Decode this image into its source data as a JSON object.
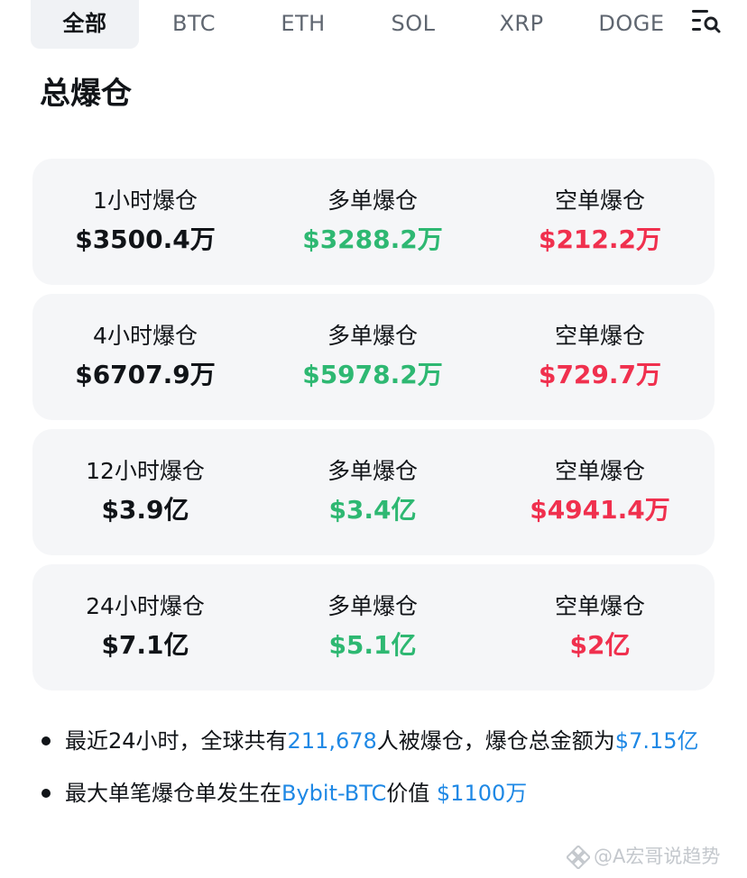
{
  "tabs": [
    {
      "label": "全部",
      "active": true
    },
    {
      "label": "BTC",
      "active": false
    },
    {
      "label": "ETH",
      "active": false
    },
    {
      "label": "SOL",
      "active": false
    },
    {
      "label": "XRP",
      "active": false
    },
    {
      "label": "DOGE",
      "active": false
    }
  ],
  "filter_icon": "search-filter-icon",
  "page_title": "总爆仓",
  "cards": [
    {
      "period": "1小时爆仓",
      "total": "$3500.4万",
      "long_label": "多单爆仓",
      "long": "$3288.2万",
      "short_label": "空单爆仓",
      "short": "$212.2万"
    },
    {
      "period": "4小时爆仓",
      "total": "$6707.9万",
      "long_label": "多单爆仓",
      "long": "$5978.2万",
      "short_label": "空单爆仓",
      "short": "$729.7万"
    },
    {
      "period": "12小时爆仓",
      "total": "$3.9亿",
      "long_label": "多单爆仓",
      "long": "$3.4亿",
      "short_label": "空单爆仓",
      "short": "$4941.4万"
    },
    {
      "period": "24小时爆仓",
      "total": "$7.1亿",
      "long_label": "多单爆仓",
      "long": "$5.1亿",
      "short_label": "空单爆仓",
      "short": "$2亿"
    }
  ],
  "summary": {
    "line1": {
      "prefix": "最近24小时，全球共有",
      "count": "211,678",
      "middle": "人被爆仓，爆仓总金额为",
      "amount": "$7.15亿"
    },
    "line2": {
      "prefix": "最大单笔爆仓单发生在",
      "exchange": "Bybit-BTC",
      "middle": "价值 ",
      "amount": "$1100万"
    }
  },
  "watermark": "@A宏哥说趋势",
  "colors": {
    "long": "#2eb872",
    "short": "#f0304e",
    "highlight": "#1e88e5",
    "active_tab_bg": "#f0f2f5",
    "card_bg": "#f5f6f8"
  }
}
